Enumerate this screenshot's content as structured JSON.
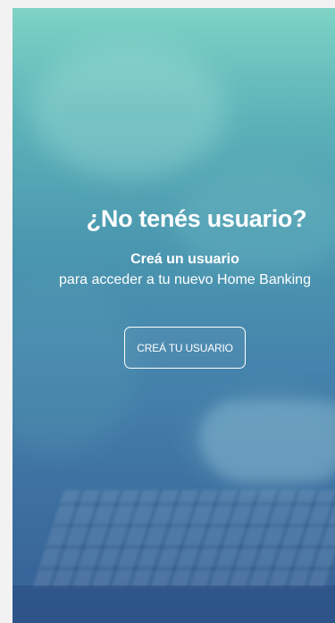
{
  "hero": {
    "title": "¿No tenés usuario?",
    "subtitle": "Creá un usuario",
    "description": "para acceder a tu nuevo Home Banking",
    "button_label": "CREÁ TU USUARIO"
  },
  "colors": {
    "gradient_top": "#7ed3c5",
    "gradient_bottom": "#365f95",
    "text": "#ffffff",
    "page_background": "#f2f2f2"
  }
}
